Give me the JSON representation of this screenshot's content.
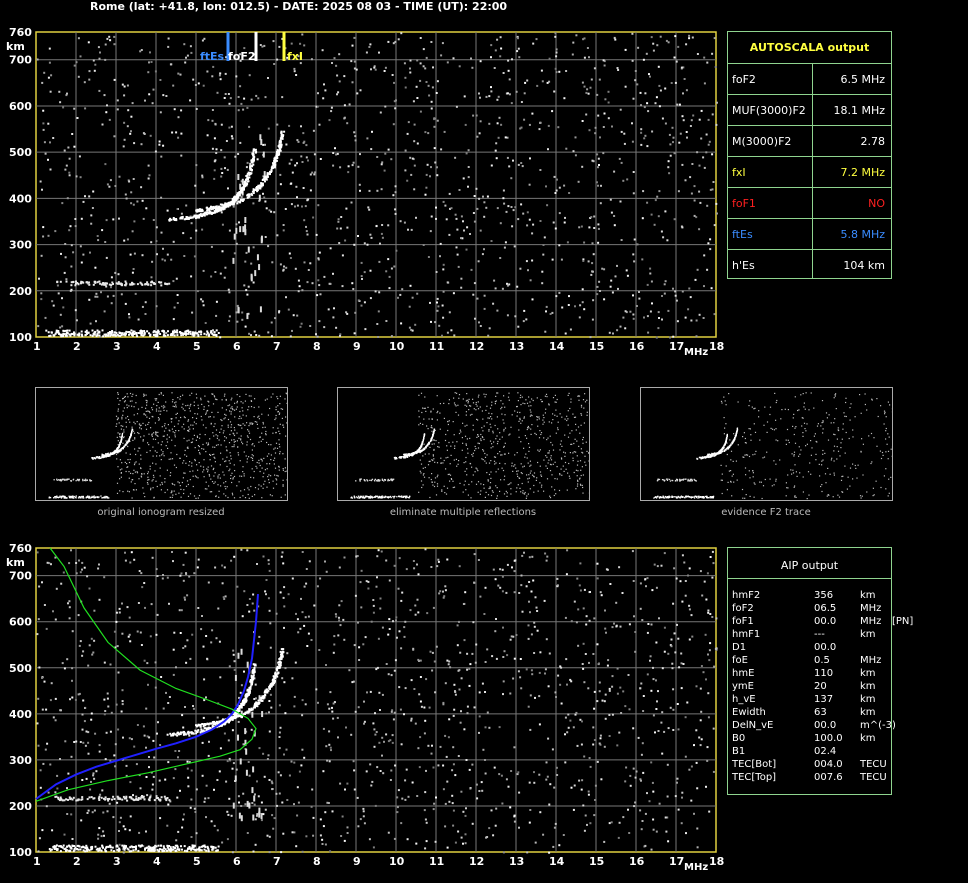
{
  "header": "Rome (lat: +41.8, lon: 012.5) - DATE: 2025 08 03 - TIME (UT): 22:00",
  "autoscala": {
    "title": "AUTOSCALA output",
    "rows": [
      {
        "key": "foF2",
        "value": "6.5 MHz",
        "color": "#ffffff"
      },
      {
        "key": "MUF(3000)F2",
        "value": "18.1 MHz",
        "color": "#ffffff"
      },
      {
        "key": "M(3000)F2",
        "value": "2.78",
        "color": "#ffffff"
      },
      {
        "key": "fxI",
        "value": "7.2 MHz",
        "color": "#ffff40"
      },
      {
        "key": "foF1",
        "value": "NO",
        "color": "#ff2020"
      },
      {
        "key": "ftEs",
        "value": "5.8 MHz",
        "color": "#3a8cff"
      },
      {
        "key": "h'Es",
        "value": "104    km",
        "color": "#ffffff"
      }
    ]
  },
  "aip": {
    "title": "AIP output",
    "rows": [
      {
        "a": "hmF2",
        "b": "356",
        "c": "km",
        "d": ""
      },
      {
        "a": "foF2",
        "b": "06.5",
        "c": "MHz",
        "d": ""
      },
      {
        "a": "foF1",
        "b": "00.0",
        "c": "MHz",
        "d": "[PN]"
      },
      {
        "a": "hmF1",
        "b": "---",
        "c": "km",
        "d": ""
      },
      {
        "a": "D1",
        "b": "00.0",
        "c": "",
        "d": ""
      },
      {
        "a": "foE",
        "b": "0.5",
        "c": "MHz",
        "d": ""
      },
      {
        "a": "hmE",
        "b": "110",
        "c": "km",
        "d": ""
      },
      {
        "a": "ymE",
        "b": "20",
        "c": "km",
        "d": ""
      },
      {
        "a": "h_vE",
        "b": "137",
        "c": "km",
        "d": ""
      },
      {
        "a": "Ewidth",
        "b": "63",
        "c": "km",
        "d": ""
      },
      {
        "a": "DelN_vE",
        "b": "00.0",
        "c": "m^(-3)",
        "d": ""
      },
      {
        "a": "B0",
        "b": "100.0",
        "c": "km",
        "d": ""
      },
      {
        "a": "B1",
        "b": "02.4",
        "c": "",
        "d": ""
      },
      {
        "a": "TEC[Bot]",
        "b": "004.0",
        "c": "TECU",
        "d": ""
      },
      {
        "a": "TEC[Top]",
        "b": "007.6",
        "c": "TECU",
        "d": ""
      }
    ]
  },
  "thumbnails": [
    {
      "caption": "original ionogram resized"
    },
    {
      "caption": "eliminate multiple reflections"
    },
    {
      "caption": "evidence F2 trace"
    }
  ],
  "chart_data": [
    {
      "type": "scatter",
      "xlabel": "MHz",
      "ylabel": "km",
      "xlim": [
        1,
        18
      ],
      "ylim": [
        100,
        760
      ],
      "xticks": [
        1,
        2,
        3,
        4,
        5,
        6,
        7,
        8,
        9,
        10,
        11,
        12,
        13,
        14,
        15,
        16,
        17,
        18
      ],
      "yticks": [
        100,
        200,
        300,
        400,
        500,
        600,
        700,
        760
      ],
      "grid": true,
      "markers": [
        {
          "label": "ftEs",
          "x": 5.8,
          "color": "#3a8cff"
        },
        {
          "label": "foF2",
          "x": 6.5,
          "color": "#ffffff"
        },
        {
          "label": "fxI",
          "x": 7.2,
          "color": "#ffff40"
        }
      ],
      "traces": {
        "o_trace": [
          [
            4.3,
            356
          ],
          [
            5.0,
            363
          ],
          [
            5.5,
            375
          ],
          [
            5.8,
            388
          ],
          [
            6.0,
            405
          ],
          [
            6.2,
            430
          ],
          [
            6.35,
            465
          ],
          [
            6.45,
            510
          ]
        ],
        "x_trace": [
          [
            5.0,
            375
          ],
          [
            5.6,
            385
          ],
          [
            6.2,
            400
          ],
          [
            6.6,
            430
          ],
          [
            6.9,
            470
          ],
          [
            7.05,
            505
          ],
          [
            7.15,
            545
          ]
        ],
        "es_trace": [
          [
            1.3,
            110
          ],
          [
            5.5,
            110
          ]
        ],
        "e2_trace": [
          [
            1.5,
            218
          ],
          [
            4.3,
            218
          ]
        ]
      }
    },
    {
      "type": "scatter",
      "xlabel": "MHz",
      "ylabel": "km",
      "xlim": [
        1,
        18
      ],
      "ylim": [
        100,
        760
      ],
      "xticks": [
        1,
        2,
        3,
        4,
        5,
        6,
        7,
        8,
        9,
        10,
        11,
        12,
        13,
        14,
        15,
        16,
        17,
        18
      ],
      "yticks": [
        100,
        200,
        300,
        400,
        500,
        600,
        700,
        760
      ],
      "grid": true,
      "series": [
        {
          "name": "",
          "color": "#2020ff",
          "points": [
            [
              1.0,
              215
            ],
            [
              1.5,
              247
            ],
            [
              2.0,
              268
            ],
            [
              2.5,
              285
            ],
            [
              3.0,
              298
            ],
            [
              3.5,
              311
            ],
            [
              4.0,
              324
            ],
            [
              4.5,
              336
            ],
            [
              5.0,
              350
            ],
            [
              5.4,
              366
            ],
            [
              5.7,
              383
            ],
            [
              5.9,
              400
            ],
            [
              6.05,
              420
            ],
            [
              6.2,
              450
            ],
            [
              6.3,
              480
            ],
            [
              6.4,
              520
            ],
            [
              6.45,
              560
            ],
            [
              6.5,
              600
            ],
            [
              6.55,
              660
            ]
          ]
        },
        {
          "name": "",
          "color": "#20e020",
          "points": [
            [
              1.0,
              210
            ],
            [
              1.8,
              235
            ],
            [
              2.8,
              255
            ],
            [
              3.8,
              272
            ],
            [
              4.8,
              292
            ],
            [
              5.6,
              308
            ],
            [
              6.1,
              322
            ],
            [
              6.4,
              345
            ],
            [
              6.5,
              368
            ],
            [
              6.3,
              390
            ],
            [
              5.9,
              410
            ],
            [
              5.3,
              430
            ],
            [
              4.5,
              455
            ],
            [
              3.6,
              495
            ],
            [
              2.8,
              555
            ],
            [
              2.2,
              630
            ],
            [
              1.7,
              720
            ],
            [
              1.35,
              760
            ]
          ]
        }
      ]
    }
  ]
}
